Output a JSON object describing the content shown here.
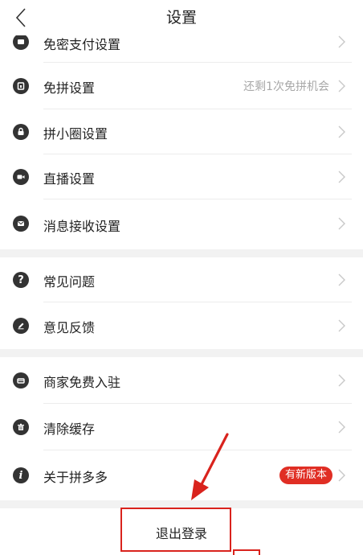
{
  "header": {
    "title": "设置"
  },
  "settings": {
    "partial_item": {
      "label": "免密支付设置"
    },
    "items": [
      {
        "label": "免拼设置",
        "note": "还剩1次免拼机会"
      },
      {
        "label": "拼小圈设置"
      },
      {
        "label": "直播设置"
      },
      {
        "label": "消息接收设置"
      },
      {
        "label": "常见问题"
      },
      {
        "label": "意见反馈"
      },
      {
        "label": "商家免费入驻"
      },
      {
        "label": "清除缓存"
      },
      {
        "label": "关于拼多多",
        "badge": "有新版本"
      }
    ]
  },
  "footer": {
    "logout_label": "退出登录"
  },
  "colors": {
    "accent": "#e02e24",
    "annotation": "#d9231d",
    "section_gap": "#f2f2f2"
  }
}
